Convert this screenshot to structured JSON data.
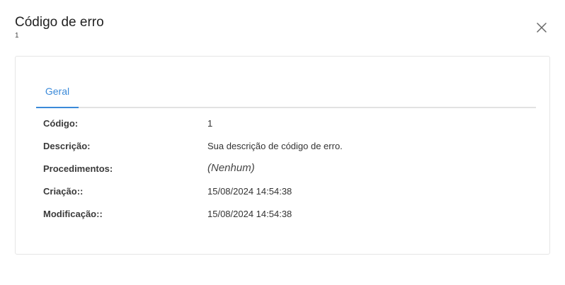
{
  "header": {
    "title": "Código de erro",
    "subtitle": "1"
  },
  "tabs": [
    {
      "label": "Geral",
      "active": true
    }
  ],
  "fields": [
    {
      "label": "Código:",
      "value": "1"
    },
    {
      "label": "Descrição:",
      "value": "Sua descrição de código de erro."
    },
    {
      "label": "Procedimentos:",
      "value": "(Nenhum)"
    },
    {
      "label": "Criação::",
      "value": "15/08/2024 14:54:38"
    },
    {
      "label": "Modificação::",
      "value": "15/08/2024 14:54:38"
    }
  ],
  "icons": {
    "close": "close-icon"
  },
  "colors": {
    "accent": "#3b8ad9",
    "border": "#e5e5e5",
    "tab_underline": "#e2e2e2"
  }
}
